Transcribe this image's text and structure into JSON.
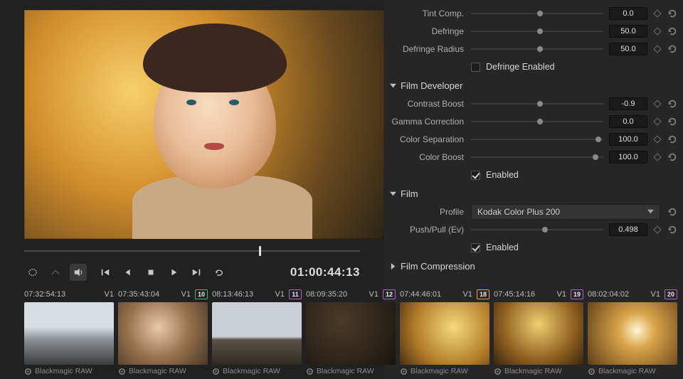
{
  "viewer": {
    "timecode": "01:00:44:13"
  },
  "inspector": {
    "top": {
      "tint_comp": {
        "label": "Tint Comp.",
        "value": "0.0",
        "pos": 50
      },
      "defringe": {
        "label": "Defringe",
        "value": "50.0",
        "pos": 50
      },
      "defr_radius": {
        "label": "Defringe Radius",
        "value": "50.0",
        "pos": 50
      },
      "defr_enabled": {
        "label": "Defringe Enabled",
        "checked": false
      }
    },
    "film_dev": {
      "title": "Film Developer",
      "contrast": {
        "label": "Contrast Boost",
        "value": "-0.9",
        "pos": 50
      },
      "gamma": {
        "label": "Gamma Correction",
        "value": "0.0",
        "pos": 50
      },
      "color_sep": {
        "label": "Color Separation",
        "value": "100.0",
        "pos": 94
      },
      "color_bst": {
        "label": "Color Boost",
        "value": "100.0",
        "pos": 92
      },
      "enabled": {
        "label": "Enabled",
        "checked": true
      }
    },
    "film": {
      "title": "Film",
      "profile_label": "Profile",
      "profile_value": "Kodak Color Plus 200",
      "push_pull": {
        "label": "Push/Pull (Ev)",
        "value": "0.498",
        "pos": 54
      },
      "enabled": {
        "label": "Enabled",
        "checked": true
      }
    },
    "film_comp": {
      "title": "Film Compression"
    }
  },
  "clips": [
    {
      "num": "",
      "tc": "07:32:54:13",
      "track": "V1",
      "codec": "Blackmagic RAW",
      "color": "#a0a0a0",
      "thumb": "th-winter"
    },
    {
      "num": "10",
      "tc": "07:35:43:04",
      "track": "V1",
      "codec": "Blackmagic RAW",
      "color": "#3fb86b",
      "thumb": "th-girl"
    },
    {
      "num": "11",
      "tc": "08:13:46:13",
      "track": "V1",
      "codec": "Blackmagic RAW",
      "color": "#b859d6",
      "thumb": "th-trees"
    },
    {
      "num": "12",
      "tc": "08:09:35:20",
      "track": "V1",
      "codec": "Blackmagic RAW",
      "color": "#b859d6",
      "thumb": "th-dark"
    },
    {
      "num": "18",
      "tc": "07:44:46:01",
      "track": "V1",
      "codec": "Blackmagic RAW",
      "color": "#f2a23a",
      "thumb": "th-gold"
    },
    {
      "num": "19",
      "tc": "07:45:14:16",
      "track": "V1",
      "codec": "Blackmagic RAW",
      "color": "#b859d6",
      "thumb": "th-gold2"
    },
    {
      "num": "20",
      "tc": "08:02:04:02",
      "track": "V1",
      "codec": "Blackmagic RAW",
      "color": "#b859d6",
      "thumb": "th-sun"
    }
  ]
}
